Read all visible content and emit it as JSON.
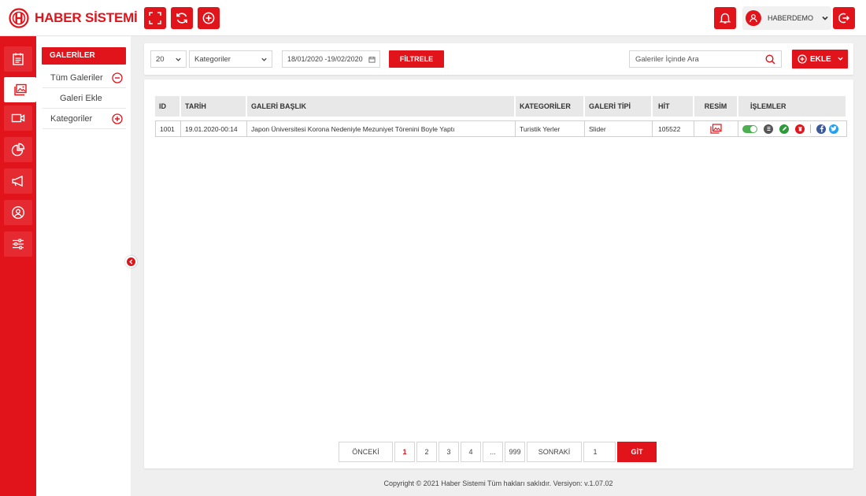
{
  "app": {
    "logo_text": "HABER SİSTEMİ"
  },
  "header": {
    "user_name": "HABERDEMO",
    "toolbar_icons": [
      "fullscreen-icon",
      "refresh-icon",
      "add-circle-icon"
    ],
    "accent_color": "#e1131b"
  },
  "rail": {
    "items": [
      "news-icon",
      "gallery-icon",
      "video-icon",
      "chart-icon",
      "megaphone-icon",
      "user-circle-icon",
      "sliders-icon"
    ],
    "active_index": 1
  },
  "subnav": {
    "title": "GALERİLER",
    "items": [
      {
        "label": "Tüm Galeriler",
        "icon": "minus-circle-icon"
      },
      {
        "label": "Galeri Ekle"
      },
      {
        "label": "Kategoriler",
        "icon": "plus-circle-icon"
      }
    ]
  },
  "filters": {
    "page_size": "20",
    "category": "Kategoriler",
    "date_range": "18/01/2020 -19/02/2020",
    "filter_label": "FİLTRELE",
    "search_placeholder": "Galeriler İçinde Ara",
    "add_label": "EKLE"
  },
  "table": {
    "columns": [
      "ID",
      "TARİH",
      "GALERİ BAŞLIK",
      "KATEGORİLER",
      "GALERİ TİPİ",
      "HİT",
      "RESİM",
      "İŞLEMLER"
    ],
    "rows": [
      {
        "id": "1001",
        "date": "19.01.2020-00:14",
        "title": "Japon Üniversitesi Korona Nedeniyle Mezuniyet Törenini Boyle Yaptı",
        "category": "Turistik Yerler",
        "type": "Slider",
        "hits": "105522"
      }
    ]
  },
  "pagination": {
    "prev": "ÖNCEKİ",
    "pages": [
      "1",
      "2",
      "3",
      "4",
      "...",
      "999"
    ],
    "current": "1",
    "next": "SONRAKİ",
    "goto_value": "1",
    "go_label": "GİT"
  },
  "footer": {
    "text": "Copyright © 2021 Haber  Sistemi  Tüm hakları saklıdır. Versiyon: v.1.07.02"
  }
}
